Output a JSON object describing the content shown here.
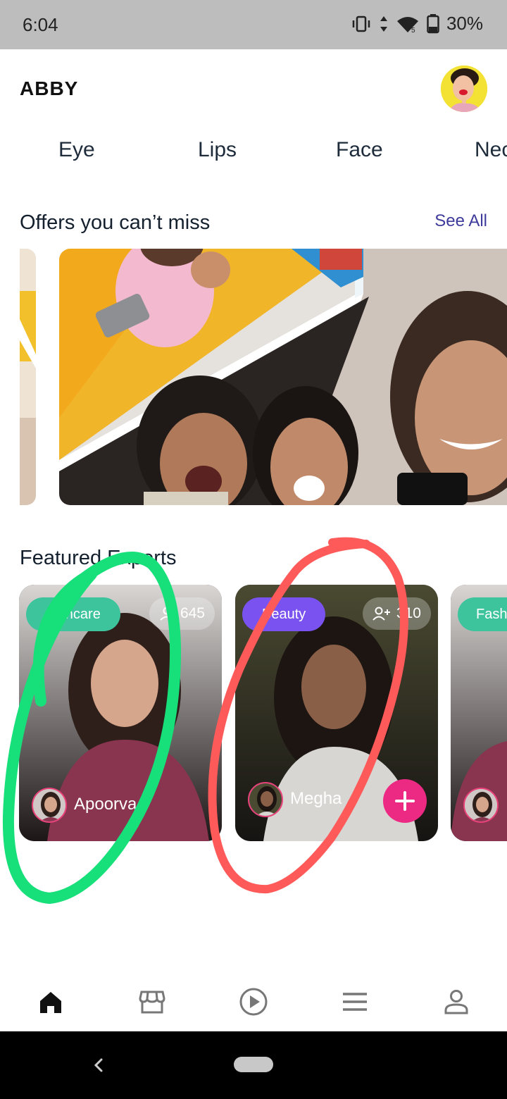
{
  "status_bar": {
    "time": "6:04",
    "battery": "30%"
  },
  "header": {
    "logo": "ABBY",
    "avatar_icon": "user-avatar-icon"
  },
  "tabs": [
    "Eye",
    "Lips",
    "Face",
    "Nec"
  ],
  "offers": {
    "title": "Offers you can’t miss",
    "see_all": "See All"
  },
  "experts": {
    "title": "Featured Experts",
    "cards": [
      {
        "category": "Skincare",
        "count": "645",
        "name": "Apoorva",
        "chip_color": "#3ec49d"
      },
      {
        "category": "Beauty",
        "count": "310",
        "name": "Megha",
        "chip_color": "#7a52ef"
      },
      {
        "category": "Fash",
        "count": "",
        "name": "",
        "chip_color": "#3ec49d"
      }
    ]
  },
  "bottom_nav": [
    "home-icon",
    "store-icon",
    "play-icon",
    "menu-icon",
    "profile-icon"
  ],
  "colors": {
    "accent": "#ec2a84",
    "link": "#3f3b9c",
    "annotation_green": "#17e07a",
    "annotation_red": "#ff5a5a"
  }
}
